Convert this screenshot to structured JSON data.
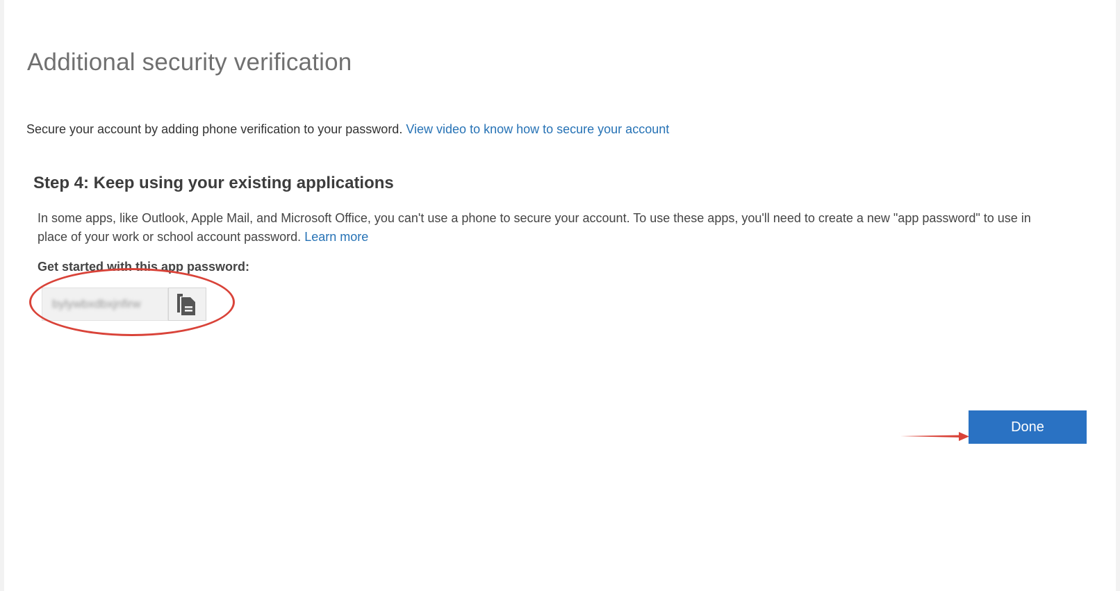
{
  "page": {
    "title": "Additional security verification",
    "intro_text": "Secure your account by adding phone verification to your password.",
    "intro_link": "View video to know how to secure your account"
  },
  "step": {
    "title": "Step 4: Keep using your existing applications",
    "description": "In some apps, like Outlook, Apple Mail, and Microsoft Office, you can't use a phone to secure your account. To use these apps, you'll need to create a new \"app password\" to use in place of your work or school account password.",
    "learn_more": "Learn more",
    "get_started_label": "Get started with this app password:",
    "app_password": "bylywbxdbxjnfirw",
    "copy_icon": "copy-icon"
  },
  "actions": {
    "done_label": "Done"
  },
  "colors": {
    "link": "#2672b5",
    "primary_button": "#2a72c3",
    "annotation": "#d94339"
  }
}
